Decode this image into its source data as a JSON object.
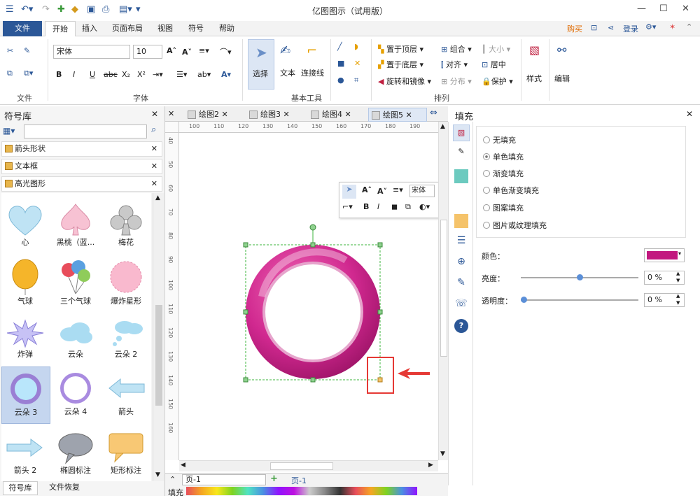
{
  "app": {
    "title": "亿图图示（试用版）"
  },
  "menu": {
    "file": "文件",
    "tabs": [
      "开始",
      "插入",
      "页面布局",
      "视图",
      "符号",
      "帮助"
    ],
    "right": {
      "buy": "购买",
      "login": "登录"
    }
  },
  "ribbon": {
    "font_name": "宋体",
    "font_size": "10",
    "groups": {
      "file": "文件",
      "font": "字体",
      "basic_tools": "基本工具",
      "arrange": "排列"
    },
    "tools": {
      "select": "选择",
      "text": "文本",
      "connector": "连接线",
      "style": "样式",
      "edit": "编辑"
    },
    "arrange": {
      "bring_front": "置于顶层",
      "send_back": "置于底层",
      "rotate_mirror": "旋转和镜像",
      "group": "组合",
      "align": "对齐",
      "distribute": "分布",
      "size": "大小",
      "center": "居中",
      "protect": "保护"
    }
  },
  "library": {
    "title": "符号库",
    "categories": [
      "箭头形状",
      "文本框",
      "高光图形"
    ],
    "shapes": [
      "心",
      "黑桃（蓝...",
      "梅花",
      "气球",
      "三个气球",
      "爆炸星形",
      "炸弹",
      "云朵",
      "云朵 2",
      "云朵 3",
      "云朵 4",
      "箭头",
      "箭头 2",
      "椭圆标注",
      "矩形标注"
    ],
    "bottom_tabs": [
      "符号库",
      "文件恢复"
    ]
  },
  "documents": {
    "tabs": [
      "绘图2",
      "绘图3",
      "绘图4",
      "绘图5"
    ]
  },
  "ruler": {
    "h": [
      "100",
      "110",
      "120",
      "130",
      "140",
      "150",
      "160",
      "170",
      "180",
      "190"
    ],
    "v": [
      "40",
      "50",
      "60",
      "70",
      "80",
      "90",
      "100",
      "110",
      "120",
      "130",
      "140",
      "150",
      "160"
    ]
  },
  "floating_toolbar": {
    "font": "宋体"
  },
  "fill_panel": {
    "title": "填充",
    "options": [
      "无填充",
      "单色填充",
      "渐变填充",
      "单色渐变填充",
      "图案填充",
      "图片或纹理填充"
    ],
    "selected": "单色填充",
    "color_label": "颜色：",
    "color_value": "#c2187f",
    "brightness_label": "亮度：",
    "brightness": "0 %",
    "transparency_label": "透明度：",
    "transparency": "0 %"
  },
  "status": {
    "page": "页-1",
    "page_tab": "页-1",
    "fill": "填充"
  }
}
